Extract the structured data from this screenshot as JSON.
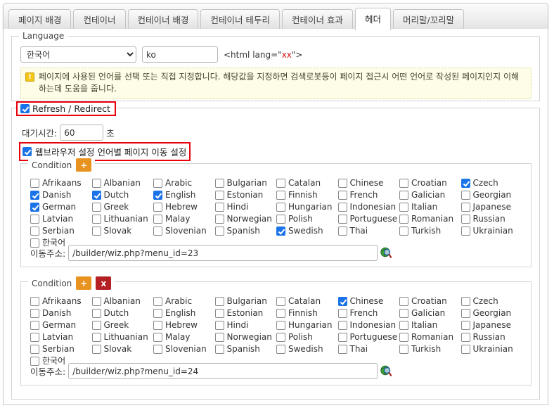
{
  "tabs": [
    {
      "label": "페이지 배경",
      "active": false
    },
    {
      "label": "컨테이너",
      "active": false
    },
    {
      "label": "컨테이너 배경",
      "active": false
    },
    {
      "label": "컨테이너 테두리",
      "active": false
    },
    {
      "label": "컨테이너 효과",
      "active": false
    },
    {
      "label": "헤더",
      "active": true
    },
    {
      "label": "머리말/꼬리말",
      "active": false
    }
  ],
  "language": {
    "legend": "Language",
    "selected": "한국어",
    "options": [
      "한국어"
    ],
    "code_value": "ko",
    "code_placeholder": "",
    "hint_prefix": "<html lang=\"",
    "hint_xx": "xx",
    "hint_suffix": "\">",
    "notice_icon": "warning-icon",
    "notice_text": "페이지에 사용된 언어를 선택 또는 직접 지정합니다. 해당값을 지정하면 검색로봇등이 페이지 접근시 어떤 언어로 작성된 페이지인지 이해하는데 도움을 줍니다."
  },
  "refresh": {
    "legend": "Refresh / Redirect",
    "legend_checked": true,
    "wait_label": "대기시간:",
    "wait_value": "60",
    "wait_unit": "초",
    "browser_option_label": "웹브라우저 설정 언어별 페이지 이동 설정",
    "browser_option_checked": true
  },
  "conditions": [
    {
      "legend": "Condition",
      "add_label": "+",
      "has_delete": false,
      "delete_label": "x",
      "languages": [
        {
          "label": "Afrikaans",
          "checked": false
        },
        {
          "label": "Albanian",
          "checked": false
        },
        {
          "label": "Arabic",
          "checked": false
        },
        {
          "label": "Bulgarian",
          "checked": false
        },
        {
          "label": "Catalan",
          "checked": false
        },
        {
          "label": "Chinese",
          "checked": false
        },
        {
          "label": "Croatian",
          "checked": false
        },
        {
          "label": "Czech",
          "checked": true
        },
        {
          "label": "Danish",
          "checked": true
        },
        {
          "label": "Dutch",
          "checked": true
        },
        {
          "label": "English",
          "checked": true
        },
        {
          "label": "Estonian",
          "checked": false
        },
        {
          "label": "Finnish",
          "checked": false
        },
        {
          "label": "French",
          "checked": false
        },
        {
          "label": "Galician",
          "checked": false
        },
        {
          "label": "Georgian",
          "checked": false
        },
        {
          "label": "German",
          "checked": true
        },
        {
          "label": "Greek",
          "checked": false
        },
        {
          "label": "Hebrew",
          "checked": false
        },
        {
          "label": "Hindi",
          "checked": false
        },
        {
          "label": "Hungarian",
          "checked": false
        },
        {
          "label": "Indonesian",
          "checked": false
        },
        {
          "label": "Italian",
          "checked": false
        },
        {
          "label": "Japanese",
          "checked": false
        },
        {
          "label": "Latvian",
          "checked": false
        },
        {
          "label": "Lithuanian",
          "checked": false
        },
        {
          "label": "Malay",
          "checked": false
        },
        {
          "label": "Norwegian",
          "checked": false
        },
        {
          "label": "Polish",
          "checked": false
        },
        {
          "label": "Portuguese",
          "checked": false
        },
        {
          "label": "Romanian",
          "checked": false
        },
        {
          "label": "Russian",
          "checked": false
        },
        {
          "label": "Serbian",
          "checked": false
        },
        {
          "label": "Slovak",
          "checked": false
        },
        {
          "label": "Slovenian",
          "checked": false
        },
        {
          "label": "Spanish",
          "checked": false
        },
        {
          "label": "Swedish",
          "checked": true
        },
        {
          "label": "Thai",
          "checked": false
        },
        {
          "label": "Turkish",
          "checked": false
        },
        {
          "label": "Ukrainian",
          "checked": false
        },
        {
          "label": "한국어",
          "checked": false
        }
      ],
      "url_label": "이동주소:",
      "url_value": "/builder/wiz.php?menu_id=23",
      "browse_icon": "globe-search-icon"
    },
    {
      "legend": "Condition",
      "add_label": "+",
      "has_delete": true,
      "delete_label": "x",
      "languages": [
        {
          "label": "Afrikaans",
          "checked": false
        },
        {
          "label": "Albanian",
          "checked": false
        },
        {
          "label": "Arabic",
          "checked": false
        },
        {
          "label": "Bulgarian",
          "checked": false
        },
        {
          "label": "Catalan",
          "checked": false
        },
        {
          "label": "Chinese",
          "checked": true
        },
        {
          "label": "Croatian",
          "checked": false
        },
        {
          "label": "Czech",
          "checked": false
        },
        {
          "label": "Danish",
          "checked": false
        },
        {
          "label": "Dutch",
          "checked": false
        },
        {
          "label": "English",
          "checked": false
        },
        {
          "label": "Estonian",
          "checked": false
        },
        {
          "label": "Finnish",
          "checked": false
        },
        {
          "label": "French",
          "checked": false
        },
        {
          "label": "Galician",
          "checked": false
        },
        {
          "label": "Georgian",
          "checked": false
        },
        {
          "label": "German",
          "checked": false
        },
        {
          "label": "Greek",
          "checked": false
        },
        {
          "label": "Hebrew",
          "checked": false
        },
        {
          "label": "Hindi",
          "checked": false
        },
        {
          "label": "Hungarian",
          "checked": false
        },
        {
          "label": "Indonesian",
          "checked": false
        },
        {
          "label": "Italian",
          "checked": false
        },
        {
          "label": "Japanese",
          "checked": false
        },
        {
          "label": "Latvian",
          "checked": false
        },
        {
          "label": "Lithuanian",
          "checked": false
        },
        {
          "label": "Malay",
          "checked": false
        },
        {
          "label": "Norwegian",
          "checked": false
        },
        {
          "label": "Polish",
          "checked": false
        },
        {
          "label": "Portuguese",
          "checked": false
        },
        {
          "label": "Romanian",
          "checked": false
        },
        {
          "label": "Russian",
          "checked": false
        },
        {
          "label": "Serbian",
          "checked": false
        },
        {
          "label": "Slovak",
          "checked": false
        },
        {
          "label": "Slovenian",
          "checked": false
        },
        {
          "label": "Spanish",
          "checked": false
        },
        {
          "label": "Swedish",
          "checked": false
        },
        {
          "label": "Thai",
          "checked": false
        },
        {
          "label": "Turkish",
          "checked": false
        },
        {
          "label": "Ukrainian",
          "checked": false
        },
        {
          "label": "한국어",
          "checked": false
        }
      ],
      "url_label": "이동주소:",
      "url_value": "/builder/wiz.php?menu_id=24",
      "browse_icon": "globe-search-icon"
    }
  ],
  "colors": {
    "accent_blue": "#1a73e8",
    "add_orange": "#e8921f",
    "delete_red": "#b52025",
    "highlight_red": "#e8000a",
    "notice_bg": "#fdfde8",
    "code_red": "#d41414"
  }
}
